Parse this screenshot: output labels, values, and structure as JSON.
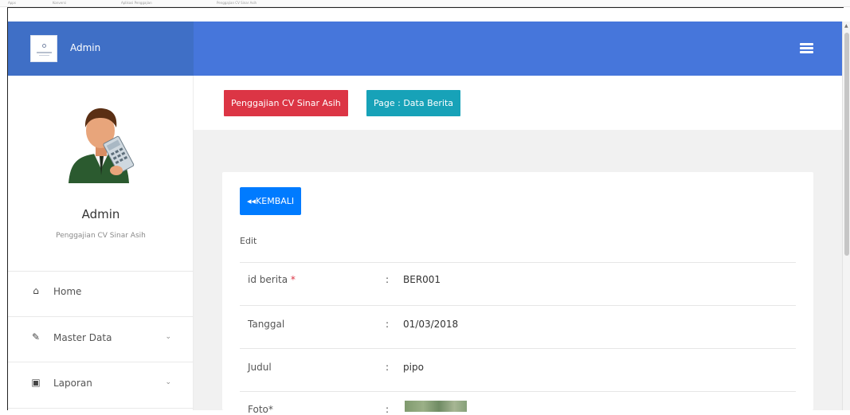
{
  "bookmarks": [
    "Apps",
    "Konversi",
    "Aplikasi Penggajian",
    "Penggajian CV Sinar Asih"
  ],
  "brand": {
    "title": "Admin"
  },
  "sidebar": {
    "user_name": "Admin",
    "user_role": "Penggajian CV Sinar Asih",
    "items": [
      {
        "icon": "home-icon",
        "label": "Home"
      },
      {
        "icon": "edit-icon",
        "label": "Master Data"
      },
      {
        "icon": "briefcase-icon",
        "label": "Laporan"
      }
    ]
  },
  "breadcrumb": {
    "app": "Penggajian CV Sinar Asih",
    "page": "Page : Data Berita"
  },
  "form": {
    "back_label": "◂◂KEMBALI",
    "title": "Edit",
    "colon": ":",
    "fields": [
      {
        "label": "id berita",
        "required_mark": "*",
        "value": "BER001"
      },
      {
        "label": "Tanggal",
        "value": "01/03/2018"
      },
      {
        "label": "Judul",
        "value": "pipo"
      },
      {
        "label": "Foto*",
        "value": ""
      }
    ]
  },
  "colors": {
    "topbar": "#4676db",
    "sidebar_header": "#3f6fc6",
    "badge_red": "#dc3545",
    "badge_teal": "#17a2b8",
    "button_primary": "#007bff"
  }
}
